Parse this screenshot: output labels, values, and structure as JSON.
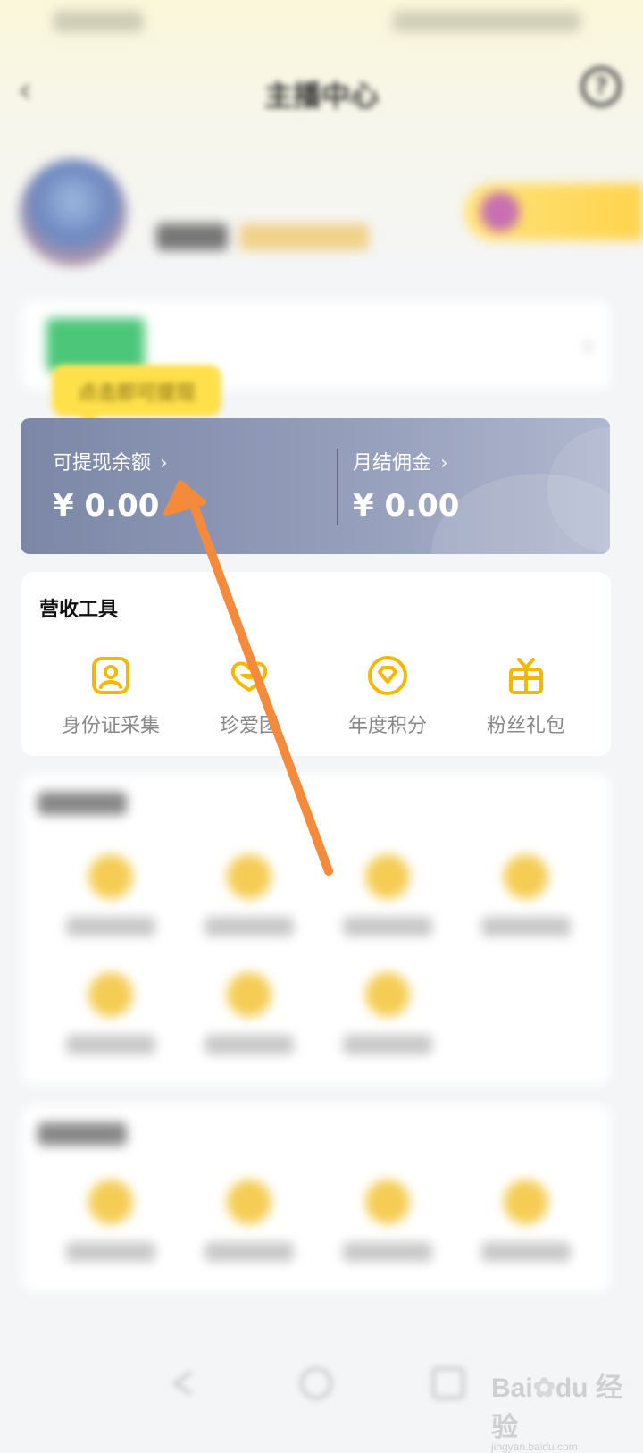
{
  "nav": {
    "back_icon": "chevron-left-icon",
    "title": "主播中心",
    "help_icon": "help-circle-icon"
  },
  "tooltip": {
    "text": "点击即可提现"
  },
  "balance": {
    "withdrawable_label": "可提现余额",
    "withdrawable_amount": "¥ 0.00",
    "monthly_label": "月结佣金",
    "monthly_amount": "¥ 0.00",
    "chevron": "›"
  },
  "revenue_tools": {
    "title": "营收工具",
    "items": [
      {
        "label": "身份证采集",
        "icon": "id-card-icon"
      },
      {
        "label": "珍爱团",
        "icon": "heart-group-icon"
      },
      {
        "label": "年度积分",
        "icon": "diamond-badge-icon"
      },
      {
        "label": "粉丝礼包",
        "icon": "gift-box-icon"
      }
    ]
  },
  "colors": {
    "accent": "#F5B800",
    "card_gradient_start": "#7C87A7",
    "arrow": "#F58A3A"
  }
}
